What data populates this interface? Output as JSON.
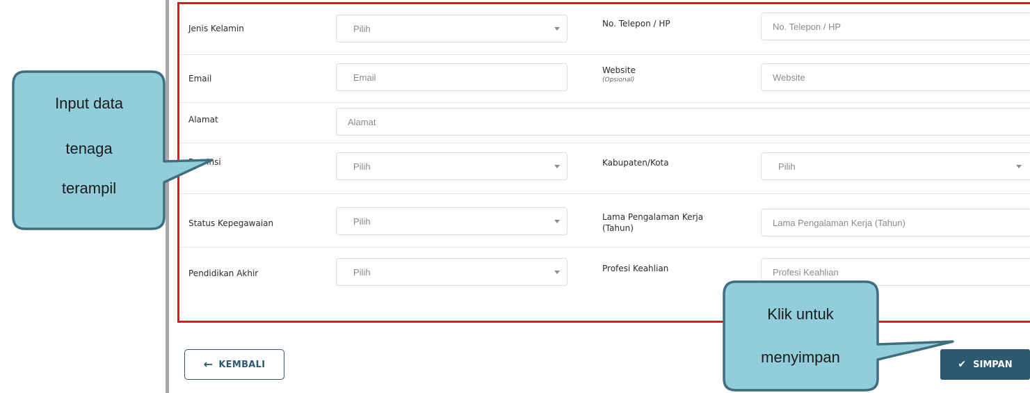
{
  "form": {
    "jenis_kelamin": {
      "label": "Jenis Kelamin",
      "placeholder": "Pilih"
    },
    "no_telepon": {
      "label": "No. Telepon / HP",
      "placeholder": "No. Telepon / HP"
    },
    "email": {
      "label": "Email",
      "placeholder": "Email"
    },
    "website": {
      "label": "Website",
      "sublabel": "(Opsional)",
      "placeholder": "Website"
    },
    "alamat": {
      "label": "Alamat",
      "placeholder": "Alamat"
    },
    "provinsi": {
      "label": "Provinsi",
      "placeholder": "Pilih"
    },
    "kabupaten": {
      "label": "Kabupaten/Kota",
      "placeholder": "Pilih"
    },
    "status_kepegawaian": {
      "label": "Status Kepegawaian",
      "placeholder": "Pilih"
    },
    "lama_pengalaman": {
      "label_line1": "Lama Pengalaman Kerja",
      "label_line2": "(Tahun)",
      "placeholder": "Lama Pengalaman Kerja (Tahun)"
    },
    "pendidikan_akhir": {
      "label": "Pendidikan Akhir",
      "placeholder": "Pilih"
    },
    "profesi_keahlian": {
      "label": "Profesi Keahlian",
      "placeholder": "Profesi Keahlian"
    }
  },
  "buttons": {
    "back_label": "KEMBALI",
    "save_label": "SIMPAN"
  },
  "callouts": {
    "input": [
      "Input data",
      "tenaga",
      "terampil"
    ],
    "save": [
      "Klik untuk",
      "menyimpan"
    ]
  },
  "colors": {
    "frame_border": "#e8141c",
    "button_primary": "#2e5a71",
    "callout_fill": "#92cddc",
    "callout_border": "#3f6f7e"
  }
}
